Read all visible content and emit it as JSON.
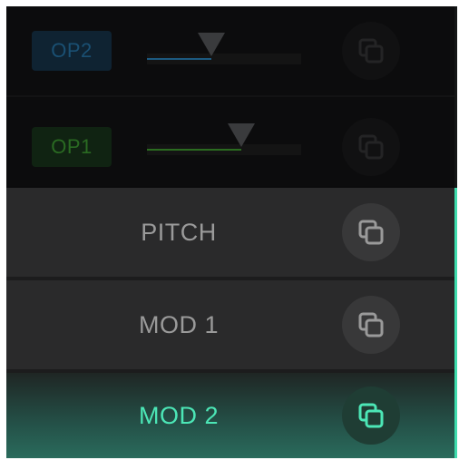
{
  "operators": [
    {
      "label": "OP2",
      "level": 0.42,
      "badge_bg": "#0f2332",
      "badge_fg": "#1a5073",
      "fill_color": "#1c5a7f"
    },
    {
      "label": "OP1",
      "level": 0.61,
      "badge_bg": "#102312",
      "badge_fg": "#2a6a22",
      "fill_color": "#2b6c20"
    }
  ],
  "envelope_tabs": [
    {
      "label": "PITCH",
      "selected": false
    },
    {
      "label": "MOD 1",
      "selected": false
    },
    {
      "label": "MOD 2",
      "selected": true
    }
  ],
  "colors": {
    "accent": "#3fdcae",
    "tab_bg": "#2a2a2b",
    "inactive_text": "#9a9a9a"
  },
  "icons": {
    "copy": "copy-icon",
    "slider_thumb": "triangle-down-icon"
  }
}
